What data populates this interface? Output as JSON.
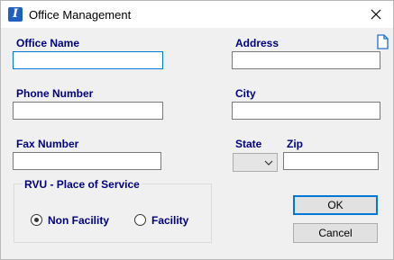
{
  "window": {
    "title": "Office Management",
    "app_icon_letter": "I"
  },
  "fields": {
    "office_name": {
      "label": "Office Name",
      "value": ""
    },
    "address": {
      "label": "Address",
      "value": ""
    },
    "phone_number": {
      "label": "Phone Number",
      "value": ""
    },
    "city": {
      "label": "City",
      "value": ""
    },
    "fax_number": {
      "label": "Fax Number",
      "value": ""
    },
    "state": {
      "label": "State",
      "value": ""
    },
    "zip": {
      "label": "Zip",
      "value": ""
    }
  },
  "place_of_service": {
    "title": "RVU - Place of Service",
    "options": [
      {
        "label": "Non Facility",
        "selected": true
      },
      {
        "label": "Facility",
        "selected": false
      }
    ]
  },
  "buttons": {
    "ok": "OK",
    "cancel": "Cancel"
  },
  "colors": {
    "label": "#000080",
    "focus_border": "#0078d7",
    "background": "#f0f0f0"
  },
  "icons": [
    "app-icon",
    "close-icon",
    "document-icon",
    "chevron-down-icon"
  ]
}
